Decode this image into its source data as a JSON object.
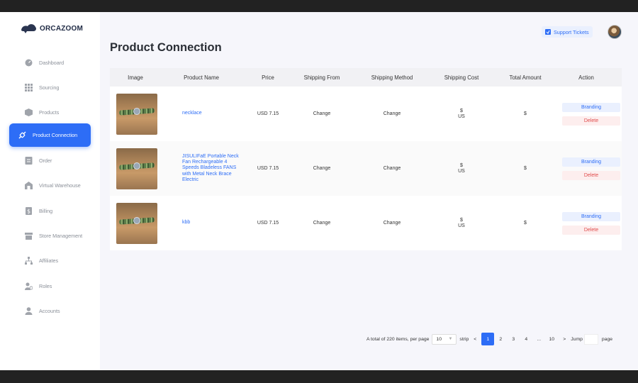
{
  "brand": {
    "orca": "ORCA",
    "zoom": "ZOOM"
  },
  "sidebar": {
    "items": [
      {
        "label": "Dashboard",
        "icon": "dashboard-icon"
      },
      {
        "label": "Sourcing",
        "icon": "grid-icon"
      },
      {
        "label": "Products",
        "icon": "box-icon"
      },
      {
        "label": "Product Connection",
        "icon": "link-icon"
      },
      {
        "label": "Order",
        "icon": "order-icon"
      },
      {
        "label": "Virtual Warehouse",
        "icon": "warehouse-icon"
      },
      {
        "label": "Billing",
        "icon": "billing-icon"
      },
      {
        "label": "Store Management",
        "icon": "store-icon"
      },
      {
        "label": "Affiliates",
        "icon": "affiliates-icon"
      },
      {
        "label": "Roles",
        "icon": "roles-icon"
      },
      {
        "label": "Accounts",
        "icon": "account-icon"
      }
    ]
  },
  "header": {
    "support_label": "Support Tickets"
  },
  "page": {
    "title": "Product Connection"
  },
  "table": {
    "columns": [
      "Image",
      "Product Name",
      "Price",
      "Shipping From",
      "Shipping Method",
      "Shipping Cost",
      "Total Amount",
      "Action"
    ],
    "rows": [
      {
        "name": "necklace",
        "price": "USD 7.15",
        "from": "Change",
        "method": "Change",
        "cost_symbol": "$",
        "cost_region": "US",
        "total": "$",
        "brand_btn": "Branding",
        "delete_btn": "Delete"
      },
      {
        "name": "JISULIFaE Portable Neck Fan Rechargeable 4 Speeds Bladeless FANS with Metal Neck Brace Electric",
        "price": "USD 7.15",
        "from": "Change",
        "method": "Change",
        "cost_symbol": "$",
        "cost_region": "US",
        "total": "$",
        "brand_btn": "Branding",
        "delete_btn": "Delete"
      },
      {
        "name": "kbb",
        "price": "USD 7.15",
        "from": "Change",
        "method": "Change",
        "cost_symbol": "$",
        "cost_region": "US",
        "total": "$",
        "brand_btn": "Branding",
        "delete_btn": "Delete"
      }
    ]
  },
  "pager": {
    "total_text": "A total of 220 items, per page",
    "per_page": "10",
    "strip": "strip",
    "prev": "<",
    "pages": [
      "1",
      "2",
      "3",
      "4",
      "...",
      "10"
    ],
    "current": "1",
    "next": ">",
    "jump": "Jump",
    "page_word": "page"
  },
  "colors": {
    "accent": "#2d6df6",
    "danger": "#e04b4b"
  }
}
